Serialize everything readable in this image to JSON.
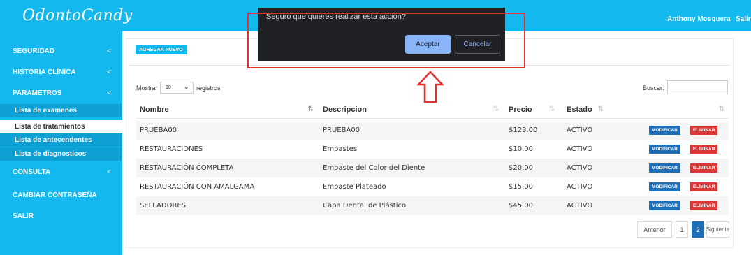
{
  "brand": {
    "name": "OdontoCandy"
  },
  "header": {
    "user": "Anthony Mosquera",
    "logout": "Salir"
  },
  "sidebar": {
    "items": [
      {
        "label": "SEGURIDAD",
        "chevron": "<"
      },
      {
        "label": "HISTORIA CLÍNICA",
        "chevron": "<"
      },
      {
        "label": "PARAMETROS",
        "chevron": "<"
      },
      {
        "label": "CONSULTA",
        "chevron": "<"
      },
      {
        "label": "CAMBIAR CONTRASEÑA"
      },
      {
        "label": "SALIR"
      }
    ],
    "subitems": [
      {
        "label": "Lista de examenes"
      },
      {
        "label": "Lista de tratamientos",
        "active": true
      },
      {
        "label": "Lista de antecendentes"
      },
      {
        "label": "Lista de diagnosticos"
      }
    ]
  },
  "main": {
    "add_button": "AGREGAR NUEVO",
    "length": {
      "label_before": "Mostrar",
      "value": "10",
      "label_after": "registros"
    },
    "search": {
      "label": "Buscar:",
      "value": ""
    }
  },
  "table": {
    "headers": [
      "Nombre",
      "Descripcion",
      "Precio",
      "Estado",
      ""
    ],
    "rows": [
      {
        "nombre": "PRUEBA00",
        "descripcion": "PRUEBA00",
        "precio": "$123.00",
        "estado": "ACTIVO"
      },
      {
        "nombre": "RESTAURACIONES",
        "descripcion": "Empastes",
        "precio": "$10.00",
        "estado": "ACTIVO"
      },
      {
        "nombre": "RESTAURACIÓN COMPLETA",
        "descripcion": "Empaste del Color del Diente",
        "precio": "$20.00",
        "estado": "ACTIVO"
      },
      {
        "nombre": "RESTAURACIÓN CON AMALGAMA",
        "descripcion": "Empaste Plateado",
        "precio": "$15.00",
        "estado": "ACTIVO"
      },
      {
        "nombre": "SELLADORES",
        "descripcion": "Capa Dental de Plástico",
        "precio": "$45.00",
        "estado": "ACTIVO"
      }
    ],
    "row_actions": {
      "modify": "MODIFICAR",
      "delete": "ELIMINAR"
    }
  },
  "pagination": {
    "prev": "Anterior",
    "pages": [
      "1",
      "2"
    ],
    "current": "2",
    "next": "Siguiente"
  },
  "dialog": {
    "message": "Seguro que quieres realizar esta accion?",
    "ok": "Aceptar",
    "cancel": "Cancelar"
  },
  "colors": {
    "brand": "#12b8ee",
    "primary": "#1f6fb8",
    "danger": "#dc3737",
    "annotation": "#e53030"
  },
  "icons": {
    "sort": "sort-icon",
    "chevron": "chevron-left-icon",
    "annotation": "up-arrow-icon"
  }
}
